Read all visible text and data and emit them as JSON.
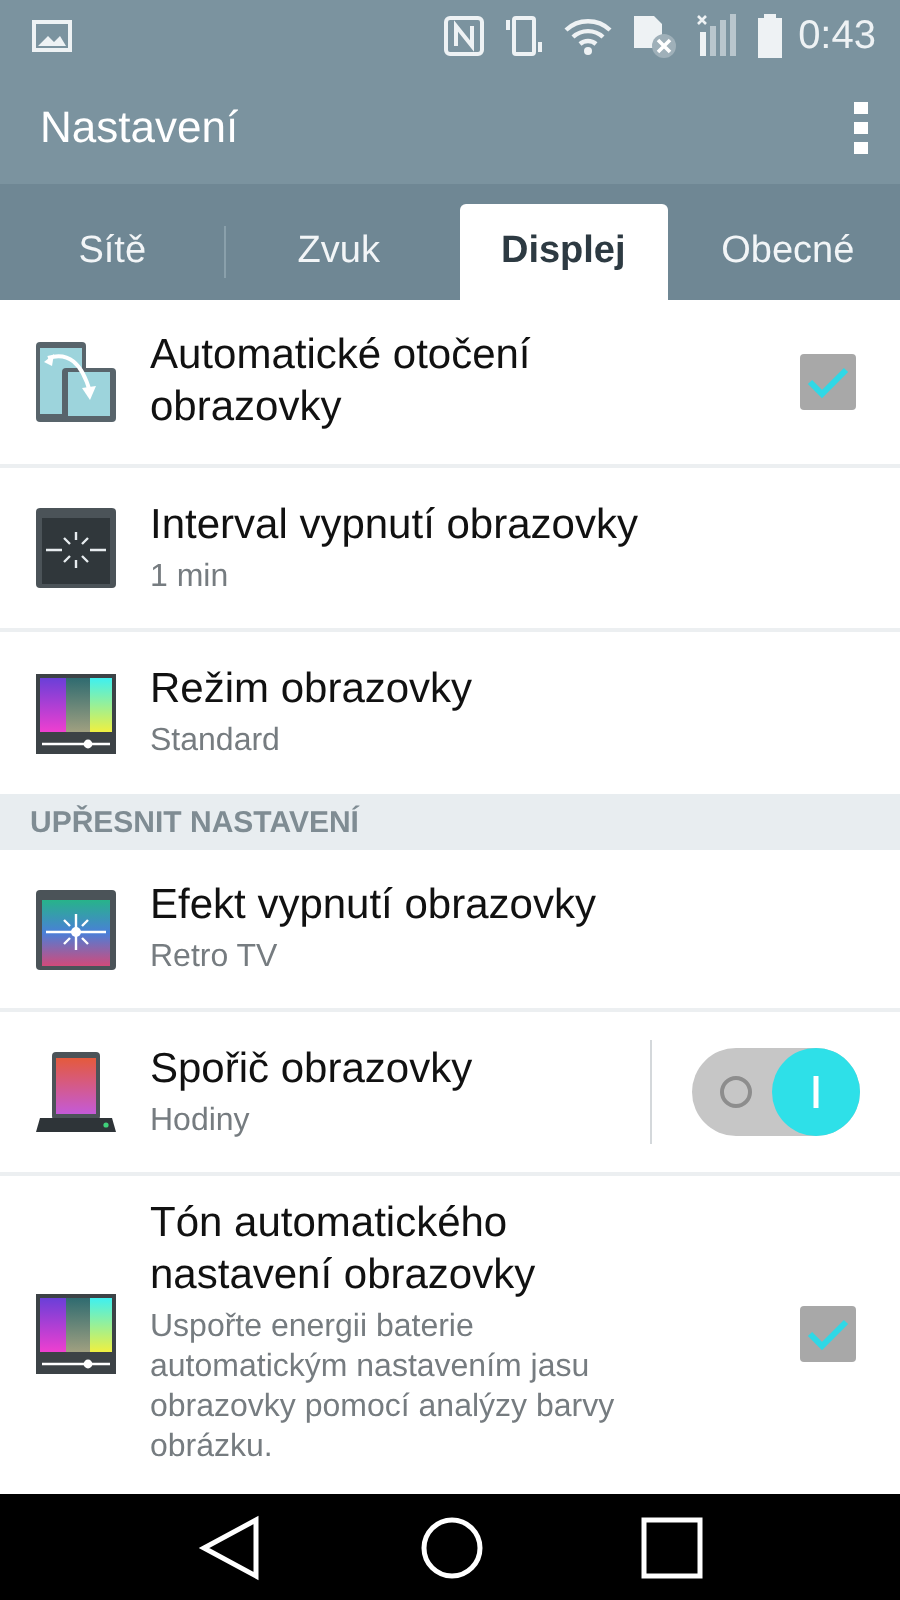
{
  "status_bar": {
    "time": "0:43"
  },
  "app_bar": {
    "title": "Nastavení"
  },
  "tabs": [
    {
      "label": "Sítě",
      "selected": false
    },
    {
      "label": "Zvuk",
      "selected": false
    },
    {
      "label": "Displej",
      "selected": true
    },
    {
      "label": "Obecné",
      "selected": false
    }
  ],
  "sections": [
    {
      "items": [
        {
          "kind": "checkbox",
          "title": "Automatické otočení obrazovky",
          "checked": true
        },
        {
          "kind": "plain",
          "title": "Interval vypnutí obrazovky",
          "summary": "1 min"
        },
        {
          "kind": "plain",
          "title": "Režim obrazovky",
          "summary": "Standard"
        }
      ]
    },
    {
      "header": "UPŘESNIT NASTAVENÍ",
      "items": [
        {
          "kind": "plain",
          "title": "Efekt vypnutí obrazovky",
          "summary": "Retro TV"
        },
        {
          "kind": "switch",
          "title": "Spořič obrazovky",
          "summary": "Hodiny",
          "on": true
        },
        {
          "kind": "checkbox",
          "title": "Tón automatického nastavení obrazovky",
          "summary": "Uspořte energii baterie automatickým nastavením jasu obrazovky pomocí analýzy barvy obrázku.",
          "checked": true
        }
      ]
    }
  ]
}
